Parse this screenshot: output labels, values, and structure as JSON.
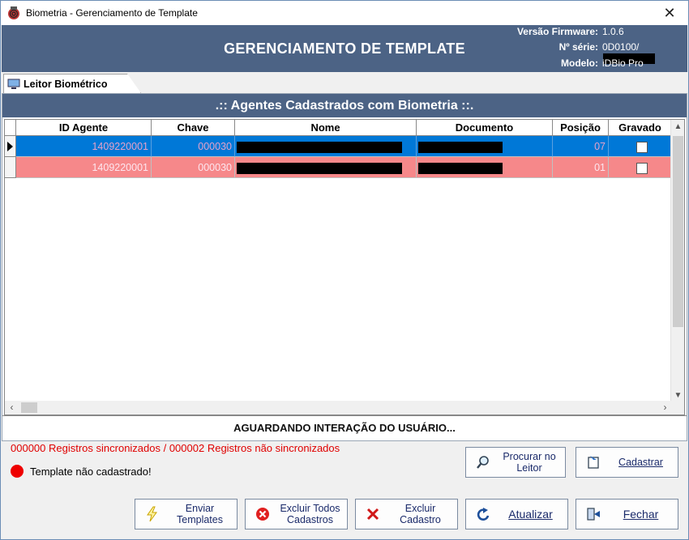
{
  "window": {
    "title": "Biometria - Gerenciamento de Template",
    "close_glyph": "✕"
  },
  "header": {
    "title": "GERENCIAMENTO DE TEMPLATE",
    "firmware_label": "Versão Firmware:",
    "firmware_value": "1.0.6",
    "serial_label": "Nº série:",
    "serial_value": "0D0100/",
    "model_label": "Modelo:",
    "model_value": "iDBio Pro"
  },
  "tab": {
    "label": "Leitor Biométrico",
    "icon": "monitor-icon"
  },
  "panel": {
    "title": ".:: Agentes Cadastrados com Biometria ::."
  },
  "grid": {
    "columns": [
      "ID Agente",
      "Chave",
      "Nome",
      "Documento",
      "Posição",
      "Gravado"
    ],
    "rows": [
      {
        "id": "1409220001",
        "chave": "000030",
        "nome": "",
        "documento": "",
        "posicao": "07",
        "gravado": false,
        "selected": true
      },
      {
        "id": "1409220001",
        "chave": "000030",
        "nome": "",
        "documento": "",
        "posicao": "01",
        "gravado": false,
        "selected": false
      }
    ]
  },
  "status": {
    "message": "AGUARDANDO INTERAÇÃO DO USUÁRIO..."
  },
  "sync": {
    "text": "000000 Registros sincronizados / 000002 Registros não sincronizados"
  },
  "template_status": {
    "text": "Template não cadastrado!"
  },
  "buttons": {
    "procurar_line1": "Procurar no",
    "procurar_line2": "Leitor",
    "cadastrar": "Cadastrar",
    "enviar_line1": "Enviar",
    "enviar_line2": "Templates",
    "excluir_todos_line1": "Excluir Todos",
    "excluir_todos_line2": "Cadastros",
    "excluir_cadastro": "Excluir Cadastro",
    "atualizar": "Atualizar",
    "fechar": "Fechar"
  },
  "colors": {
    "header_bg": "#4c6385",
    "selected_row": "#0078d7",
    "unsynced_row": "#f6888a",
    "error": "#e00000"
  }
}
